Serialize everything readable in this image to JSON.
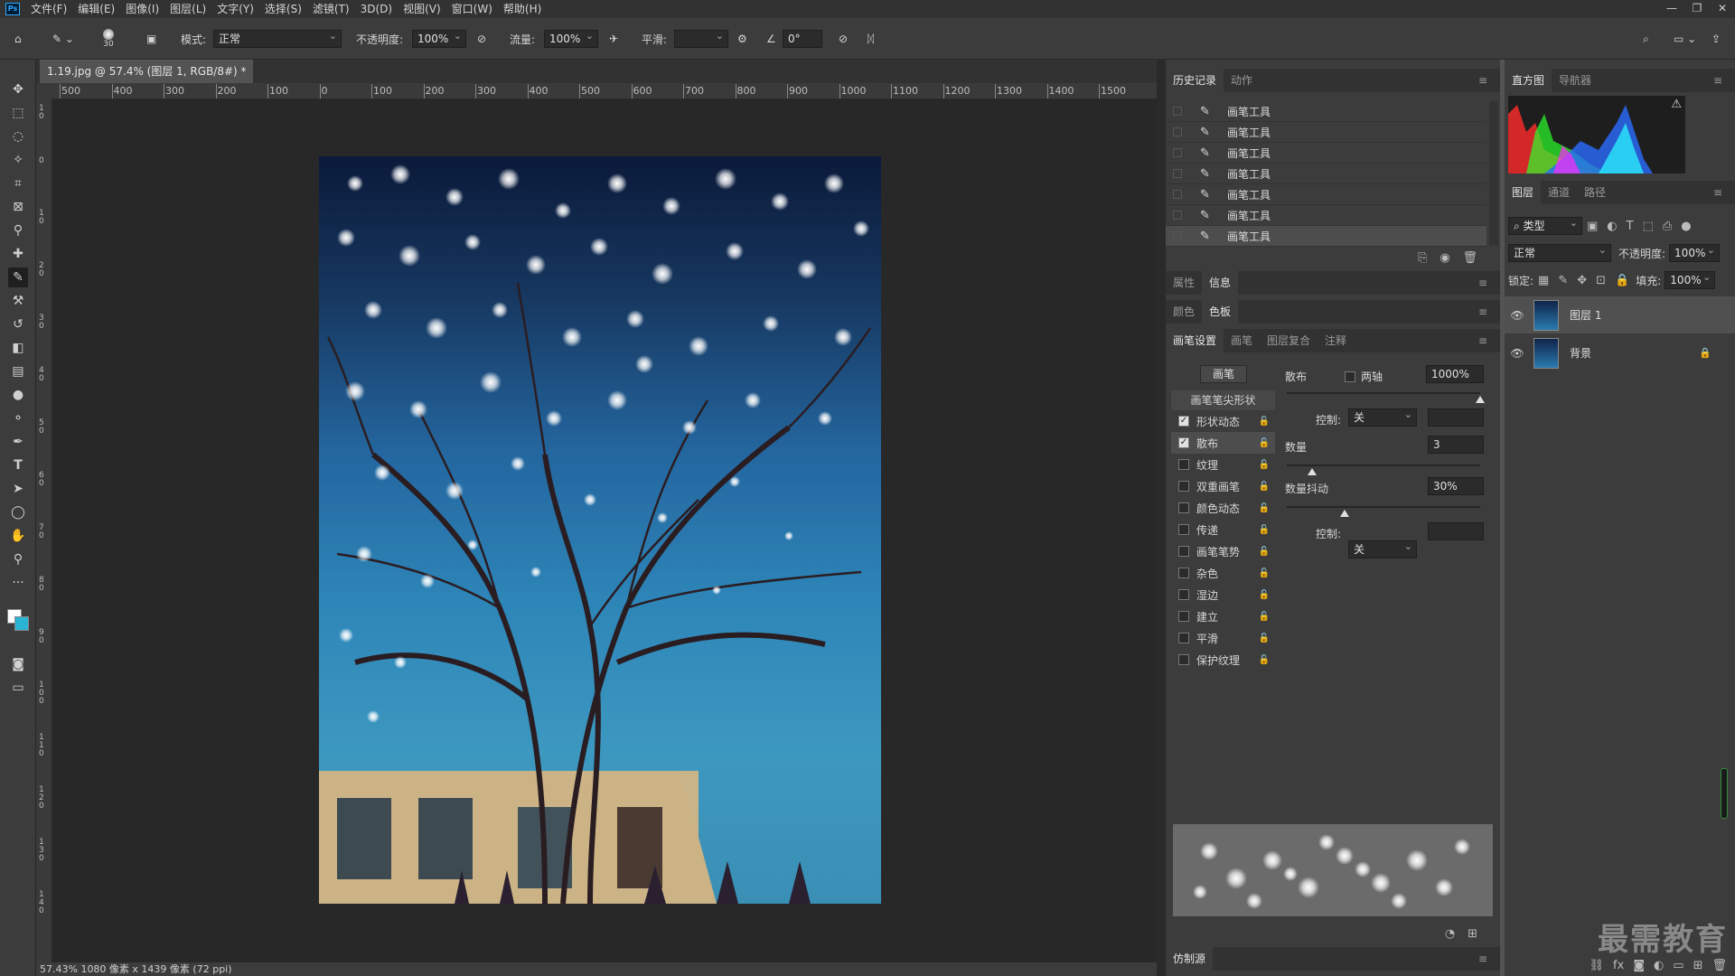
{
  "app": {
    "logo": "Ps"
  },
  "menu": [
    "文件(F)",
    "编辑(E)",
    "图像(I)",
    "图层(L)",
    "文字(Y)",
    "选择(S)",
    "滤镜(T)",
    "3D(D)",
    "视图(V)",
    "窗口(W)",
    "帮助(H)"
  ],
  "window_controls": {
    "minimize": "—",
    "restore": "❐",
    "close": "✕"
  },
  "options": {
    "brush_size": "30",
    "mode_label": "模式:",
    "mode_value": "正常",
    "opacity_label": "不透明度:",
    "opacity_value": "100%",
    "flow_label": "流量:",
    "flow_value": "100%",
    "smooth_label": "平滑:",
    "smooth_value": "",
    "angle_value": "0°"
  },
  "document": {
    "tab_title": "1.19.jpg @ 57.4% (图层 1, RGB/8#) *",
    "tab_close": "×",
    "status": "57.43%  1080 像素 x 1439 像素 (72 ppi)"
  },
  "ruler_h_labels": [
    "500",
    "400",
    "300",
    "200",
    "100",
    "0",
    "100",
    "200",
    "300",
    "400",
    "500",
    "600",
    "700",
    "800",
    "900",
    "1000",
    "1100",
    "1200",
    "1300",
    "1400",
    "1500"
  ],
  "ruler_v_labels": [
    "1 0",
    "0",
    "1 0",
    "2 0",
    "3 0",
    "4 0",
    "5 0",
    "6 0",
    "7 0",
    "8 0",
    "9 0",
    "1 0 0",
    "1 1 0",
    "1 2 0",
    "1 3 0",
    "1 4 0"
  ],
  "history_panel": {
    "tabs": [
      "历史记录",
      "动作"
    ],
    "items": [
      "画笔工具",
      "画笔工具",
      "画笔工具",
      "画笔工具",
      "画笔工具",
      "画笔工具",
      "画笔工具"
    ]
  },
  "props_panel": {
    "tabs": [
      "属性",
      "信息"
    ]
  },
  "color_panel": {
    "tabs": [
      "颜色",
      "色板"
    ]
  },
  "brush_settings": {
    "tabs": [
      "画笔设置",
      "画笔",
      "图层复合",
      "注释"
    ],
    "brushes_button": "画笔",
    "tip_shape": "画笔笔尖形状",
    "options": [
      {
        "label": "形状动态",
        "checked": true
      },
      {
        "label": "散布",
        "checked": true
      },
      {
        "label": "纹理",
        "checked": false
      },
      {
        "label": "双重画笔",
        "checked": false
      },
      {
        "label": "颜色动态",
        "checked": false
      },
      {
        "label": "传递",
        "checked": false
      },
      {
        "label": "画笔笔势",
        "checked": false
      },
      {
        "label": "杂色",
        "checked": false
      },
      {
        "label": "湿边",
        "checked": false
      },
      {
        "label": "建立",
        "checked": false
      },
      {
        "label": "平滑",
        "checked": false
      },
      {
        "label": "保护纹理",
        "checked": false
      }
    ],
    "scatter_label": "散布",
    "both_axes_label": "两轴",
    "scatter_value": "1000%",
    "scatter_level": 1.0,
    "control_label": "控制:",
    "control_value": "关",
    "count_label": "数量",
    "count_value": "3",
    "count_level": 0.13,
    "count_jitter_label": "数量抖动",
    "count_jitter_value": "30%",
    "count_jitter_level": 0.3,
    "control2_label": "控制:",
    "control2_value": "关"
  },
  "clone_panel": {
    "title": "仿制源"
  },
  "histogram_panel": {
    "tabs": [
      "直方图",
      "导航器"
    ],
    "warning": "⚠"
  },
  "layers_panel": {
    "tabs": [
      "图层",
      "通道",
      "路径"
    ],
    "filter_label": "类型",
    "blend_mode": "正常",
    "opacity_label": "不透明度:",
    "opacity_value": "100%",
    "lock_label": "锁定:",
    "fill_label": "填充:",
    "fill_value": "100%",
    "layers": [
      {
        "name": "图层 1",
        "selected": true
      },
      {
        "name": "背景",
        "locked": true
      }
    ]
  },
  "watermark": "最需教育",
  "colors": {
    "accent": "#31a8ff",
    "panel": "#3c3c3c",
    "canvas": "#282828"
  }
}
